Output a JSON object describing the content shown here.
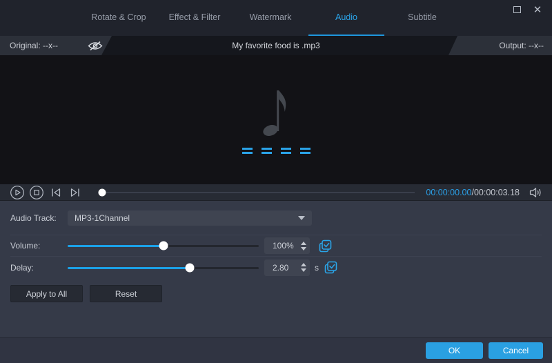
{
  "colors": {
    "accent_blue": "#2aa3e8",
    "slider_blue": "#1ba1e8",
    "icon_cyan": "#2aa6ea"
  },
  "titlebar": {
    "tabs": [
      {
        "label": "Rotate & Crop",
        "active": false
      },
      {
        "label": "Effect & Filter",
        "active": false
      },
      {
        "label": "Watermark",
        "active": false
      },
      {
        "label": "Audio",
        "active": true
      },
      {
        "label": "Subtitle",
        "active": false
      }
    ]
  },
  "preview_header": {
    "original_label": "Original: --x--",
    "filename": "My favorite food is .mp3",
    "output_label": "Output: --x--"
  },
  "player": {
    "progress_percent": 1,
    "current_time": "00:00:00.00",
    "time_separator": "/",
    "total_time": "00:00:03.18"
  },
  "settings": {
    "audio_track": {
      "label": "Audio Track:",
      "value": "MP3-1Channel"
    },
    "volume": {
      "label": "Volume:",
      "value": "100%",
      "slider_percent": 50
    },
    "delay": {
      "label": "Delay:",
      "value": "2.80",
      "unit": "s",
      "slider_percent": 64
    },
    "apply_to_all_label": "Apply to All",
    "reset_label": "Reset"
  },
  "footer": {
    "ok_label": "OK",
    "cancel_label": "Cancel"
  }
}
